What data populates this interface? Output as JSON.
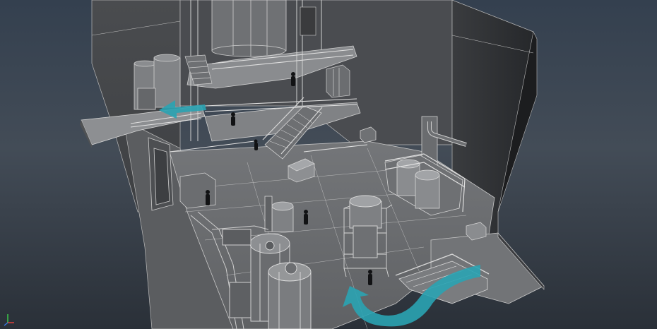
{
  "viewport": {
    "background_top": "#34404f",
    "background_bottom": "#2a3038",
    "wire_color": "#c8c8c8",
    "surface_dark": "#2c2e31",
    "surface_mid": "#5a5c5f",
    "surface_light": "#7c7e81",
    "arrow_color": "#2aa3b3"
  },
  "axis_gizmo": {
    "x_color": "#e8403a",
    "y_color": "#3bd24a",
    "z_color": "#3a7be8"
  },
  "scene": {
    "direction_arrows": [
      "upper-left-arrow",
      "lower-curved-arrow"
    ]
  }
}
